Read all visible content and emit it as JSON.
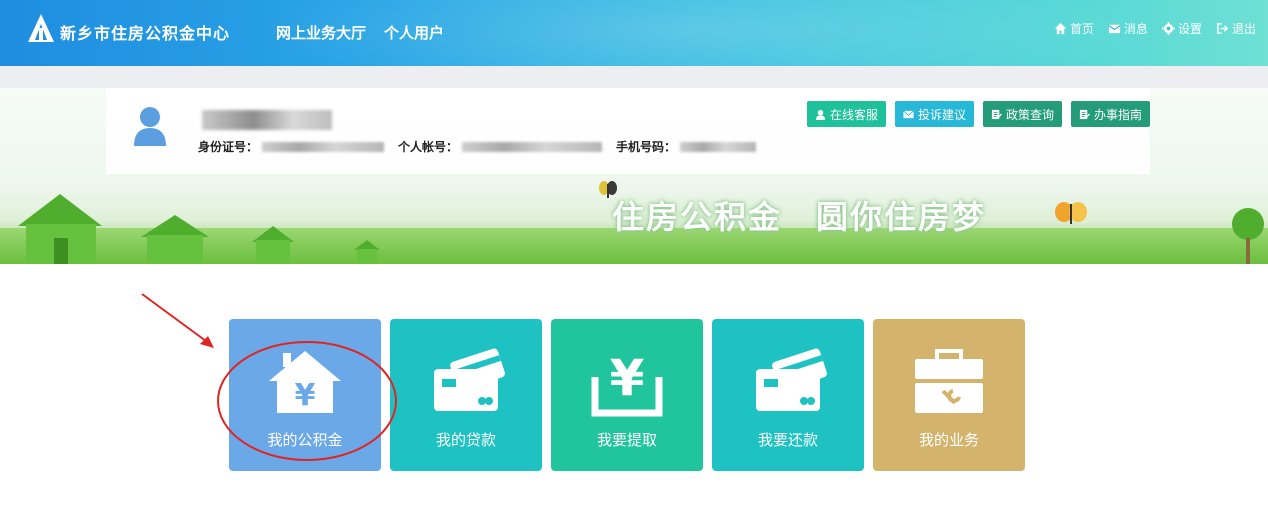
{
  "header": {
    "site_title": "新乡市住房公积金中心",
    "nav": [
      "网上业务大厅",
      "个人用户"
    ],
    "links": [
      {
        "label": "首页",
        "icon": "home-icon"
      },
      {
        "label": "消息",
        "icon": "mail-icon"
      },
      {
        "label": "设置",
        "icon": "gear-icon"
      },
      {
        "label": "退出",
        "icon": "logout-icon"
      }
    ]
  },
  "user": {
    "id_label": "身份证号：",
    "account_label": "个人帐号：",
    "phone_label": "手机号码："
  },
  "actions": [
    {
      "label": "在线客服",
      "icon": "customer-service-icon",
      "color": "#1ec19a"
    },
    {
      "label": "投诉建议",
      "icon": "envelope-icon",
      "color": "#26b8d6"
    },
    {
      "label": "政策查询",
      "icon": "document-icon",
      "color": "#249c7a"
    },
    {
      "label": "办事指南",
      "icon": "document-icon",
      "color": "#249c7a"
    }
  ],
  "banner": {
    "slogan": "住房公积金　圆你住房梦"
  },
  "tiles": [
    {
      "label": "我的公积金",
      "icon": "house-yen-icon",
      "color": "#6aa8e8"
    },
    {
      "label": "我的贷款",
      "icon": "credit-card-icon",
      "color": "#1fc2c2"
    },
    {
      "label": "我要提取",
      "icon": "yen-withdraw-icon",
      "color": "#20c49d"
    },
    {
      "label": "我要还款",
      "icon": "credit-card-icon",
      "color": "#1fc2c2"
    },
    {
      "label": "我的业务",
      "icon": "toolbox-icon",
      "color": "#d4b36c"
    }
  ],
  "colors": {
    "annotation_red": "#e02424"
  }
}
